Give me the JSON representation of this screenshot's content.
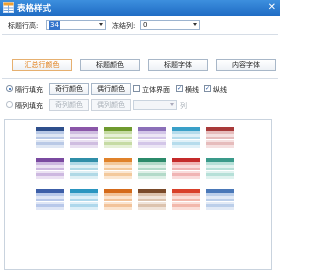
{
  "window": {
    "title": "表格样式",
    "close_glyph": "✕"
  },
  "row_header": {
    "label": "标题行高:",
    "value": "34"
  },
  "col_header": {
    "label": "冻结列:",
    "value": "0"
  },
  "tabs": [
    {
      "label": "汇总行颜色",
      "active": true
    },
    {
      "label": "标题颜色",
      "active": false
    },
    {
      "label": "标题字体",
      "active": false
    },
    {
      "label": "内容字体",
      "active": false
    }
  ],
  "row_fill": {
    "label": "隔行填充",
    "btn_odd": "奇行颜色",
    "btn_even": "偶行颜色",
    "selected": true
  },
  "options": [
    {
      "label": "立体界面",
      "checked": false
    },
    {
      "label": "横线",
      "checked": true
    },
    {
      "label": "纵线",
      "checked": true
    }
  ],
  "col_fill": {
    "label": "隔列填充",
    "btn_odd": "奇列颜色",
    "btn_even": "偶列颜色",
    "suffix": "列",
    "selected": false
  },
  "check_glyph": "✓",
  "styles": [
    {
      "hdr": "#2e4f8c",
      "a": "#b9c9e6",
      "b": "#dfe7f4"
    },
    {
      "hdr": "#8a56a8",
      "a": "#cfbde0",
      "b": "#e9e0f1"
    },
    {
      "hdr": "#6f9a2f",
      "a": "#c6dba4",
      "b": "#e6f0d6"
    },
    {
      "hdr": "#8b6fb8",
      "a": "#d3c6e8",
      "b": "#ece6f5"
    },
    {
      "hdr": "#3aa0c8",
      "a": "#b6dcec",
      "b": "#e0f1f8"
    },
    {
      "hdr": "#a83a3a",
      "a": "#e6bcbc",
      "b": "#f5e0e0"
    },
    {
      "hdr": "#7a4aa0",
      "a": "#cdb8e0",
      "b": "#ebe2f3"
    },
    {
      "hdr": "#2f8ea8",
      "a": "#b0d9e6",
      "b": "#dff0f5"
    },
    {
      "hdr": "#e0822a",
      "a": "#f3c99c",
      "b": "#fbe7d2"
    },
    {
      "hdr": "#2b8a6a",
      "a": "#b3dac9",
      "b": "#def0e7"
    },
    {
      "hdr": "#c42a2a",
      "a": "#f0b4b4",
      "b": "#fadcdc"
    },
    {
      "hdr": "#3a9a8a",
      "a": "#b6e0d8",
      "b": "#e0f2ef"
    },
    {
      "hdr": "#3c5ea8",
      "a": "#b8c8ea",
      "b": "#dfe6f6"
    },
    {
      "hdr": "#2a95c0",
      "a": "#aed8ec",
      "b": "#ddeff8"
    },
    {
      "hdr": "#d46a1a",
      "a": "#f2c39a",
      "b": "#fbe4cf"
    },
    {
      "hdr": "#7a4a2a",
      "a": "#dcc3ae",
      "b": "#f0e4da"
    },
    {
      "hdr": "#d8402a",
      "a": "#f2b8ac",
      "b": "#fbdfd9"
    },
    {
      "hdr": "#4a78b8",
      "a": "#bccfea",
      "b": "#e2eaf6"
    }
  ]
}
